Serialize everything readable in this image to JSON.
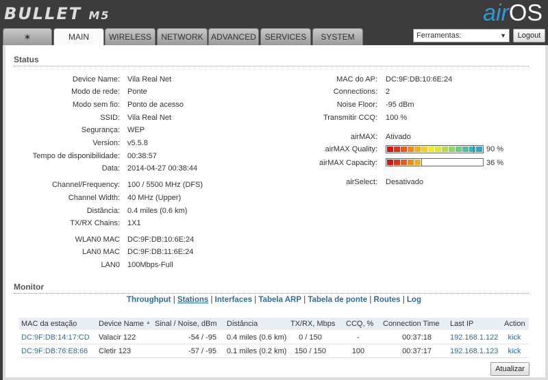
{
  "header": {
    "product": "BULLET",
    "model": "M5",
    "brand_air": "air",
    "brand_os": "OS"
  },
  "tabs": [
    {
      "label": "",
      "icon": "ubiquiti-logo-icon"
    },
    {
      "label": "MAIN"
    },
    {
      "label": "WIRELESS"
    },
    {
      "label": "NETWORK"
    },
    {
      "label": "ADVANCED"
    },
    {
      "label": "SERVICES"
    },
    {
      "label": "SYSTEM"
    }
  ],
  "active_tab": "MAIN",
  "tools": {
    "selected": "Ferramentas:",
    "logout": "Logout"
  },
  "status": {
    "title": "Status",
    "left": [
      [
        "Device Name:",
        "Vila Real Net"
      ],
      [
        "Modo de rede:",
        "Ponte"
      ],
      [
        "Modo sem fio:",
        "Ponto de acesso"
      ],
      [
        "SSID:",
        "Vila Real Net"
      ],
      [
        "Segurança:",
        "WEP"
      ],
      [
        "Version:",
        "v5.5.8"
      ],
      [
        "Tempo de disponibilidade:",
        "00:38:57"
      ],
      [
        "Data:",
        "2014-04-27 00:38:44"
      ],
      [
        "Channel/Frequency:",
        "100 / 5500 MHz (DFS)"
      ],
      [
        "Channel Width:",
        "40 MHz (Upper)"
      ],
      [
        "Distância:",
        "0.4 miles (0.6 km)"
      ],
      [
        "TX/RX Chains:",
        "1X1"
      ],
      [
        "WLAN0 MAC",
        "DC:9F:DB:10:6E:24"
      ],
      [
        "LAN0 MAC",
        "DC:9F:DB:11:6E:24"
      ],
      [
        "LAN0",
        "100Mbps-Full"
      ]
    ],
    "right": [
      [
        "MAC do AP:",
        "DC:9F:DB:10:6E:24"
      ],
      [
        "Connections:",
        "2"
      ],
      [
        "Noise Floor:",
        "-95 dBm"
      ],
      [
        "Transmitir CCQ:",
        "100 %"
      ],
      [
        "airMAX:",
        "Ativado"
      ],
      [
        "airMAX Quality:",
        "90 %"
      ],
      [
        "airMAX Capacity:",
        "36 %"
      ],
      [
        "airSelect:",
        "Desativado"
      ]
    ],
    "airmax_quality_pct": 90,
    "airmax_capacity_pct": 36
  },
  "monitor": {
    "title": "Monitor",
    "links": [
      "Throughput",
      "Stations",
      "Interfaces",
      "Tabela ARP",
      "Tabela de ponte",
      "Routes",
      "Log"
    ],
    "active_link": "Stations",
    "columns": [
      "MAC da estação",
      "Device Name",
      "Sinal / Noise, dBm",
      "Distância",
      "TX/RX, Mbps",
      "CCQ, %",
      "Connection Time",
      "Last IP",
      "Action"
    ],
    "sort_indicator": "▲",
    "rows": [
      [
        "DC:9F:DB:14:17:CD",
        "Valacir 122",
        "-54 / -95",
        "0.4 miles (0.6 km)",
        "0 / 150",
        "-",
        "00:37:18",
        "192.168.1.122",
        "kick"
      ],
      [
        "DC:9F:DB:76:E8:66",
        "Cletir 123",
        "-57 / -95",
        "0.1 miles (0.2 km)",
        "150 / 150",
        "100",
        "00:37:17",
        "192.168.1.123",
        "kick"
      ]
    ],
    "refresh": "Atualizar"
  }
}
